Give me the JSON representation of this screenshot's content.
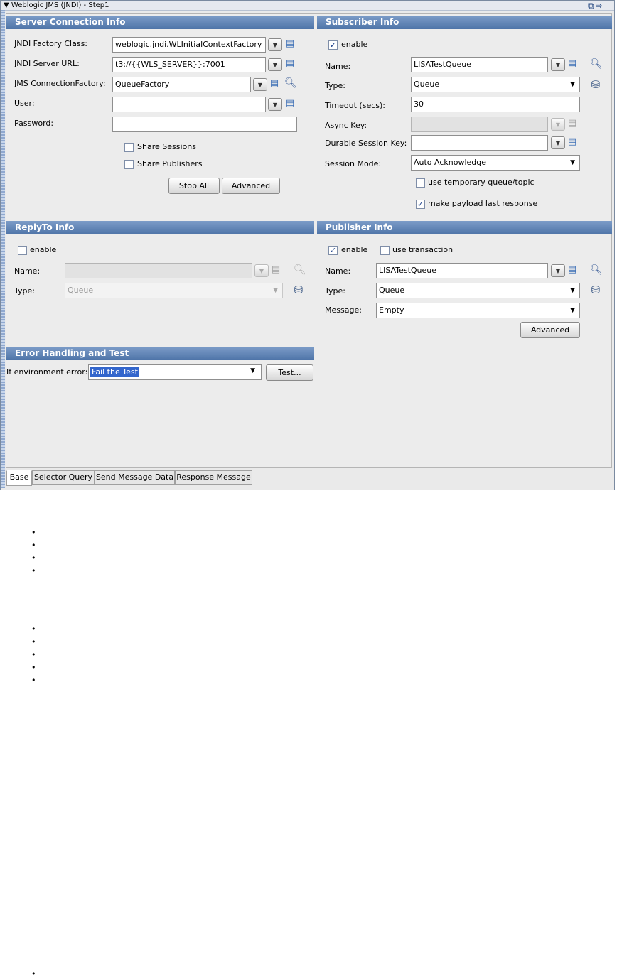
{
  "window": {
    "title": "Weblogic JMS (JNDI) - Step1"
  },
  "server": {
    "header": "Server Connection Info",
    "factory_label": "JNDI Factory Class:",
    "factory_value": "weblogic.jndi.WLInitialContextFactory",
    "url_label": "JNDI Server URL:",
    "url_value": "t3://{{WLS_SERVER}}:7001",
    "cf_label": "JMS ConnectionFactory:",
    "cf_value": "QueueFactory",
    "user_label": "User:",
    "user_value": "",
    "password_label": "Password:",
    "password_value": "",
    "share_sessions": "Share Sessions",
    "share_publishers": "Share Publishers",
    "stop_all": "Stop All",
    "advanced": "Advanced"
  },
  "subscriber": {
    "header": "Subscriber Info",
    "enable": "enable",
    "enable_checked": true,
    "name_label": "Name:",
    "name_value": "LISATestQueue",
    "type_label": "Type:",
    "type_value": "Queue",
    "timeout_label": "Timeout (secs):",
    "timeout_value": "30",
    "async_label": "Async Key:",
    "async_value": "",
    "durable_label": "Durable Session Key:",
    "durable_value": "",
    "session_label": "Session Mode:",
    "session_value": "Auto Acknowledge",
    "temp_queue": "use temporary queue/topic",
    "make_payload": "make payload last response"
  },
  "replyto": {
    "header": "ReplyTo Info",
    "enable": "enable",
    "name_label": "Name:",
    "name_value": "",
    "type_label": "Type:",
    "type_value": "Queue"
  },
  "publisher": {
    "header": "Publisher Info",
    "enable": "enable",
    "use_transaction": "use transaction",
    "name_label": "Name:",
    "name_value": "LISATestQueue",
    "type_label": "Type:",
    "type_value": "Queue",
    "message_label": "Message:",
    "message_value": "Empty",
    "advanced": "Advanced"
  },
  "error": {
    "header": "Error Handling and Test",
    "label": "If environment error:",
    "value": "Fail the Test",
    "test_button": "Test..."
  },
  "tabs": [
    "Base",
    "Selector Query",
    "Send Message Data",
    "Response Message"
  ],
  "icons": {
    "collapse": "triangle-down-icon",
    "properties": "property-sheet-icon",
    "find": "magnifier-icon",
    "type_browse": "jms-browse-icon"
  },
  "colors": {
    "section_header": "#5a7db2",
    "selection": "#3366cc"
  }
}
